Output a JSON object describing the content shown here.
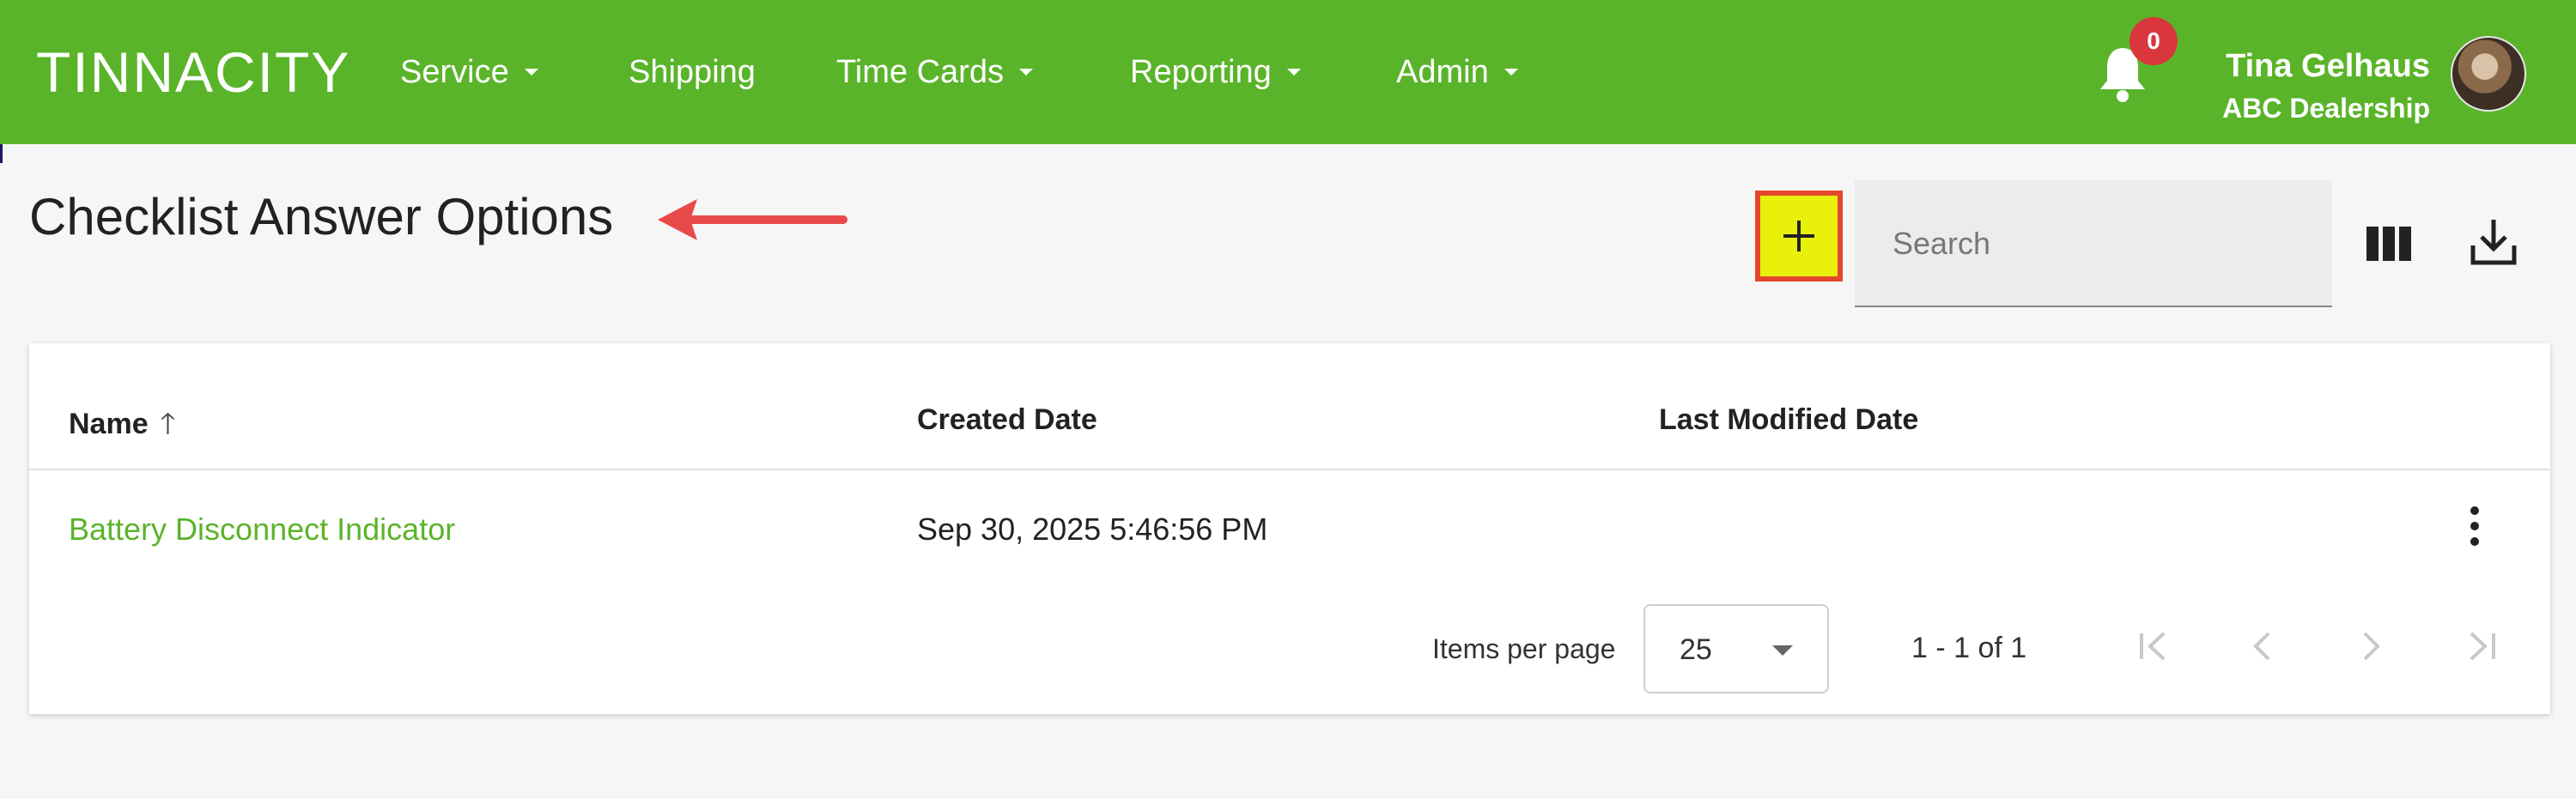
{
  "app": {
    "logo_text": "TINNACITY",
    "nav": [
      {
        "label": "Service",
        "has_dropdown": true
      },
      {
        "label": "Shipping",
        "has_dropdown": false
      },
      {
        "label": "Time Cards",
        "has_dropdown": true
      },
      {
        "label": "Reporting",
        "has_dropdown": true
      },
      {
        "label": "Admin",
        "has_dropdown": true
      }
    ],
    "notifications_count": "0",
    "user": {
      "name": "Tina Gelhaus",
      "org": "ABC Dealership"
    },
    "brand_color": "#5ab42a"
  },
  "page": {
    "title": "Checklist Answer Options",
    "search_placeholder": "Search"
  },
  "table": {
    "columns": [
      "Name",
      "Created Date",
      "Last Modified Date"
    ],
    "rows": [
      {
        "name": "Battery Disconnect Indicator",
        "created": "Sep 30, 2025 5:46:56 PM",
        "modified": ""
      }
    ]
  },
  "pager": {
    "items_per_page_label": "Items per page",
    "items_per_page": "25",
    "range": "1 - 1 of 1"
  }
}
